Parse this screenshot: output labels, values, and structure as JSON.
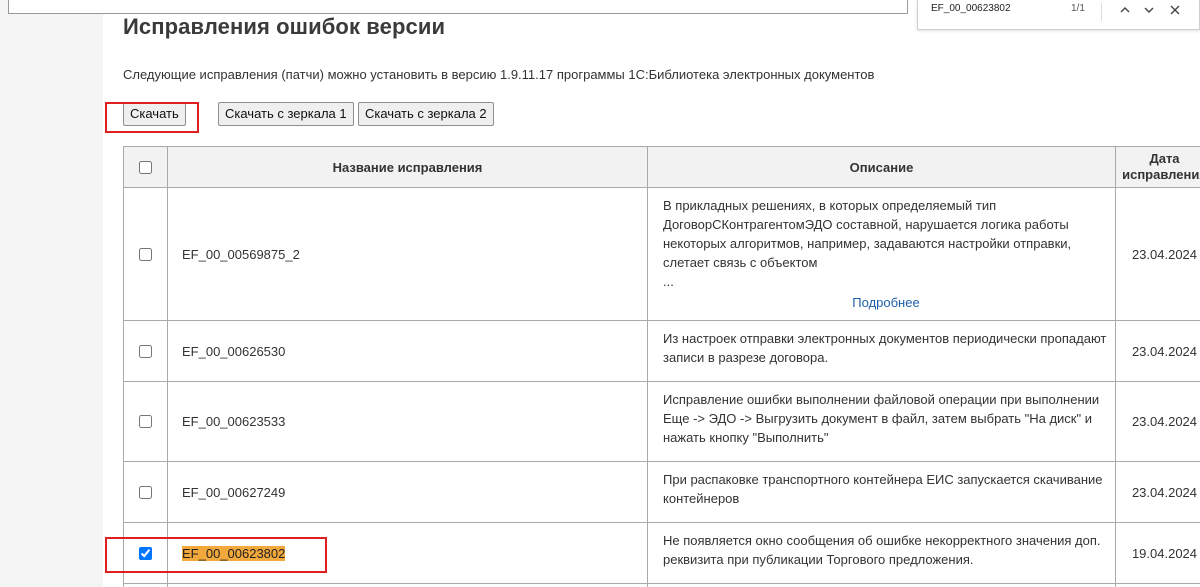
{
  "page": {
    "title": "Исправления ошибок версии",
    "intro": "Следующие исправления (патчи) можно установить в версию 1.9.11.17 программы 1С:Библиотека электронных документов"
  },
  "buttons": {
    "download": "Скачать",
    "mirror1": "Скачать с зеркала 1",
    "mirror2": "Скачать с зеркала 2"
  },
  "table": {
    "headers": {
      "name": "Название исправления",
      "description": "Описание",
      "date_line1": "Дата",
      "date_line2": "исправления"
    },
    "rows": [
      {
        "checked": false,
        "name": "EF_00_00569875_2",
        "description": "В прикладных решениях, в которых определяемый тип ДоговорСКонтрагентомЭДО составной, нарушается логика работы некоторых алгоритмов, например, задаваются настройки отправки, слетает связь с объектом",
        "ellipsis": "...",
        "more": "Подробнее",
        "date": "23.04.2024"
      },
      {
        "checked": false,
        "name": "EF_00_00626530",
        "description": "Из настроек отправки электронных документов периодически пропадают записи в разрезе договора.",
        "date": "23.04.2024"
      },
      {
        "checked": false,
        "name": "EF_00_00623533",
        "description": "Исправление ошибки выполнении файловой операции при выполнении Еще -> ЭДО -> Выгрузить документ в файл, затем выбрать \"На диск\" и нажать кнопку \"Выполнить\"",
        "date": "23.04.2024"
      },
      {
        "checked": false,
        "name": "EF_00_00627249",
        "description": "При распаковке транспортного контейнера ЕИС запускается скачивание контейнеров",
        "date": "23.04.2024"
      },
      {
        "checked": true,
        "name": "EF_00_00623802",
        "description": "Не появляется окно сообщения об ошибке некорректного значения доп. реквизита при публикации Торгового предложения.",
        "date": "19.04.2024"
      }
    ]
  },
  "find_bar": {
    "query": "EF_00_00623802",
    "count": "1/1",
    "up_icon": "chevron-up-icon",
    "down_icon": "chevron-down-icon",
    "close_icon": "close-icon"
  },
  "colors": {
    "highlight_outline": "#e02020",
    "find_match": "#f2a83a",
    "link": "#1d5fa8"
  }
}
